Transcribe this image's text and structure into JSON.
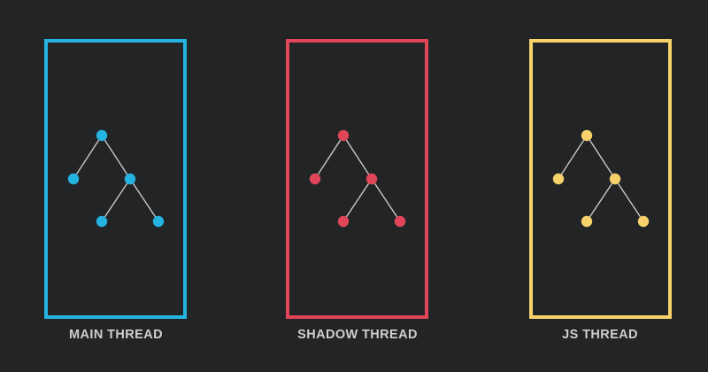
{
  "colors": {
    "background": "#222426",
    "edge": "#c9c9c9",
    "label_text": "#cfcfcf"
  },
  "threads": [
    {
      "id": "main",
      "label": "MAIN THREAD",
      "color": "#25b3e2"
    },
    {
      "id": "shadow",
      "label": "SHADOW THREAD",
      "color": "#e04558"
    },
    {
      "id": "js",
      "label": "JS THREAD",
      "color": "#f7d26a"
    }
  ],
  "tree": {
    "nodes": [
      "root",
      "left",
      "right",
      "right-left",
      "right-right"
    ],
    "edges": [
      [
        "root",
        "left"
      ],
      [
        "root",
        "right"
      ],
      [
        "right",
        "right-left"
      ],
      [
        "right",
        "right-right"
      ]
    ]
  }
}
